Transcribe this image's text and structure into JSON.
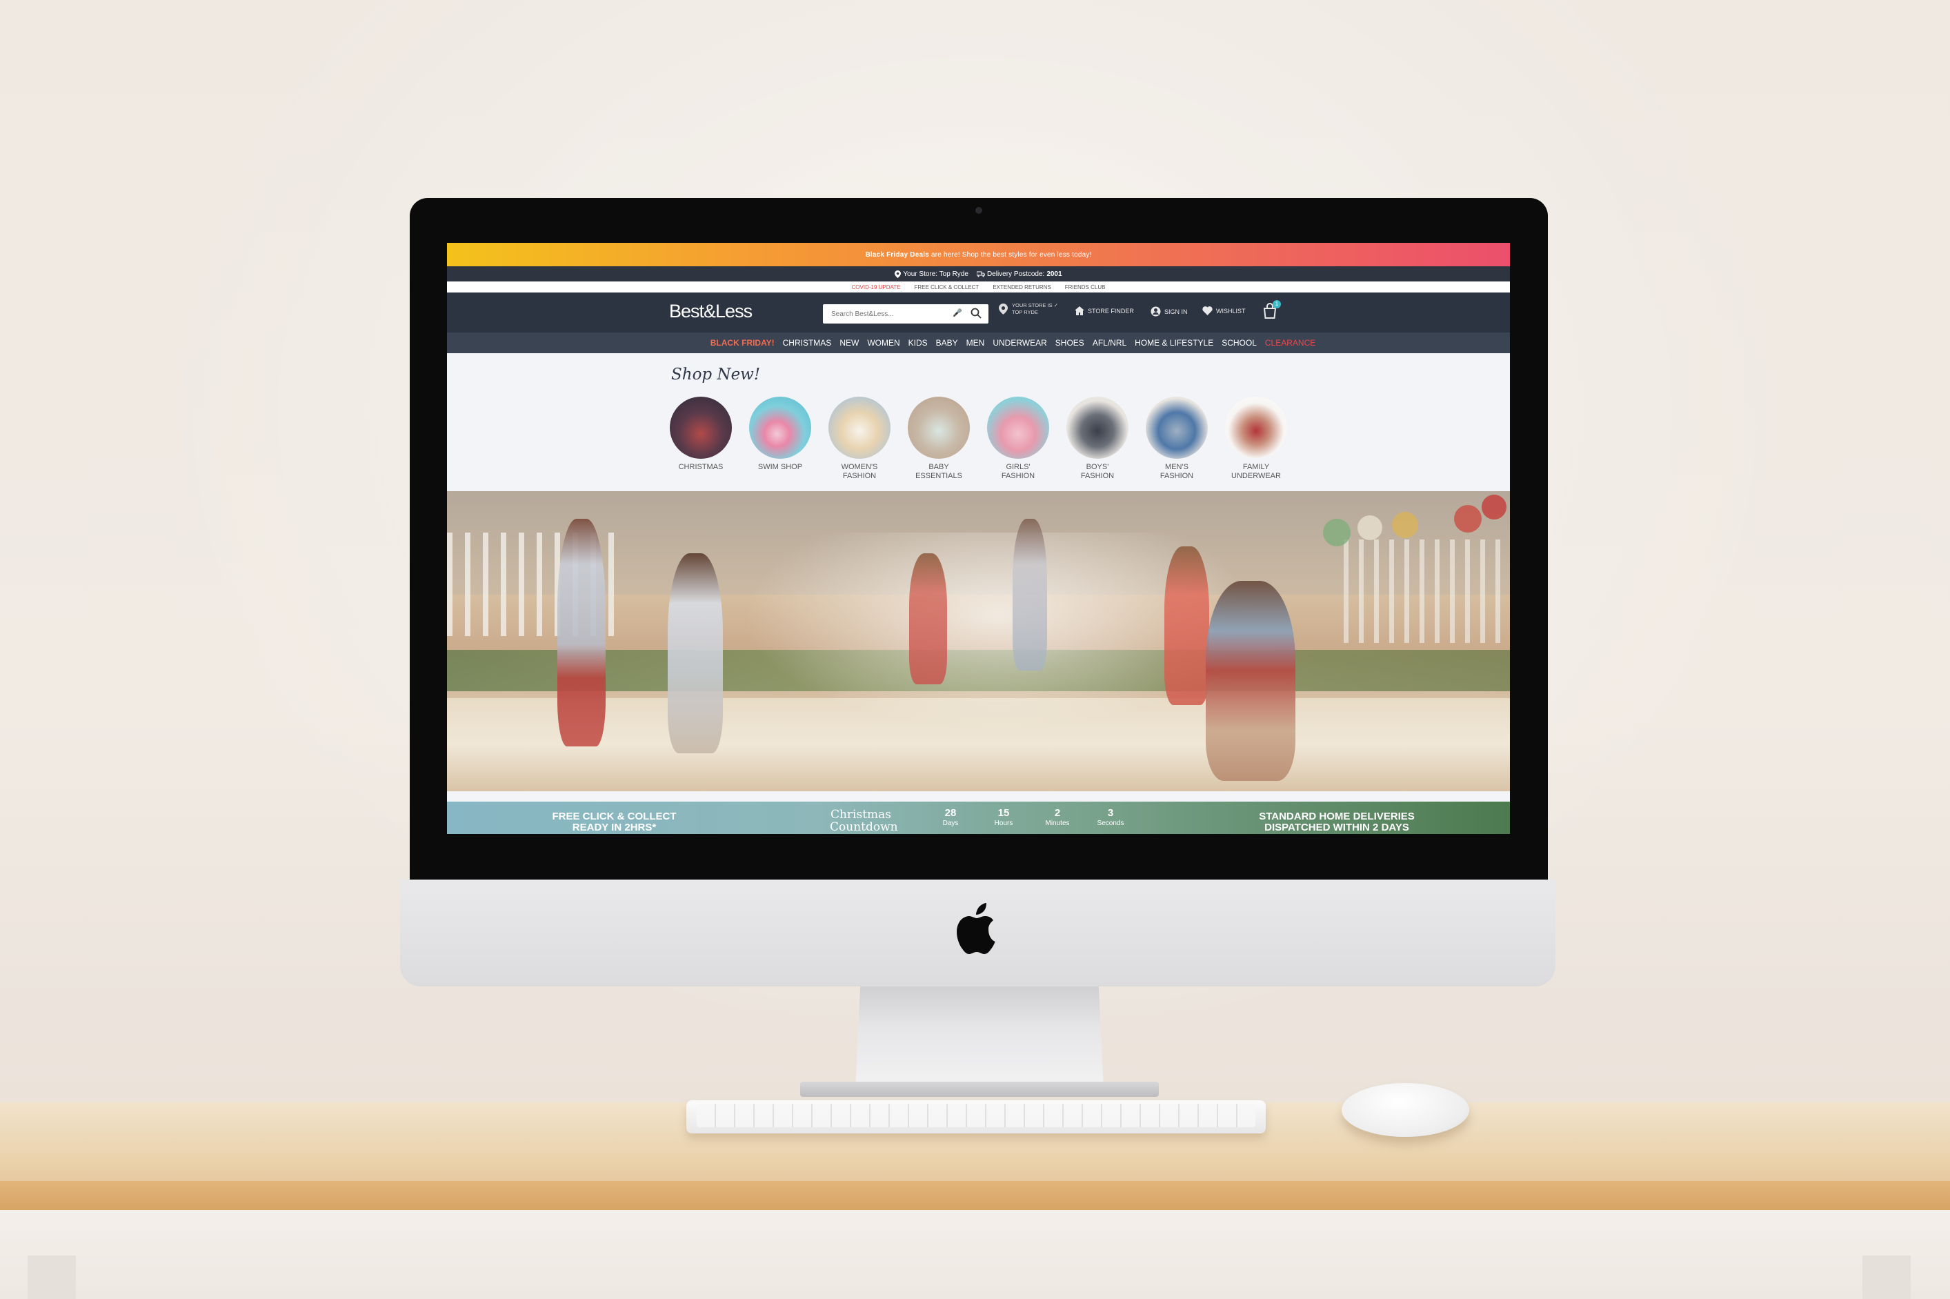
{
  "promo": {
    "strong": "Black Friday Deals",
    "rest": "are here! Shop the best styles for even less today!"
  },
  "store_bar": {
    "store_label": "Your Store: Top Ryde",
    "delivery_label": "Delivery Postcode:",
    "postcode": "2001"
  },
  "utility_links": [
    "COVID-19 UPDATE",
    "FREE CLICK & COLLECT",
    "EXTENDED RETURNS",
    "FRIENDS CLUB"
  ],
  "header": {
    "logo": "Best&Less",
    "search_placeholder": "Search Best&Less...",
    "store_line1": "YOUR STORE IS",
    "store_line2": "TOP RYDE",
    "store_finder": "STORE FINDER",
    "sign_in": "SIGN IN",
    "wishlist": "WISHLIST",
    "bag_count": "1"
  },
  "nav": [
    "BLACK FRIDAY!",
    "CHRISTMAS",
    "NEW",
    "WOMEN",
    "KIDS",
    "BABY",
    "MEN",
    "UNDERWEAR",
    "SHOES",
    "AFL/NRL",
    "HOME & LIFESTYLE",
    "SCHOOL",
    "CLEARANCE"
  ],
  "shop_new": {
    "title": "Shop New!",
    "categories": [
      {
        "line1": "CHRISTMAS",
        "line2": ""
      },
      {
        "line1": "SWIM SHOP",
        "line2": ""
      },
      {
        "line1": "WOMEN'S",
        "line2": "FASHION"
      },
      {
        "line1": "BABY",
        "line2": "ESSENTIALS"
      },
      {
        "line1": "GIRLS'",
        "line2": "FASHION"
      },
      {
        "line1": "BOYS'",
        "line2": "FASHION"
      },
      {
        "line1": "MEN'S",
        "line2": "FASHION"
      },
      {
        "line1": "FAMILY",
        "line2": "UNDERWEAR"
      }
    ]
  },
  "strip": {
    "left_line1": "FREE CLICK & COLLECT",
    "left_line2": "READY IN 2HRS*",
    "countdown_line1": "Christmas",
    "countdown_line2": "Countdown",
    "days": "28",
    "days_label": "Days",
    "hours": "15",
    "hours_label": "Hours",
    "minutes": "2",
    "minutes_label": "Minutes",
    "seconds": "3",
    "seconds_label": "Seconds",
    "right_line1": "STANDARD HOME DELIVERIES",
    "right_line2": "DISPATCHED WITHIN 2 DAYS"
  },
  "colors": {
    "header": "#2d3441",
    "nav": "#3a4452",
    "black_friday": "#f26c50",
    "clearance": "#f2444c",
    "bag_badge": "#3fb9c6"
  }
}
